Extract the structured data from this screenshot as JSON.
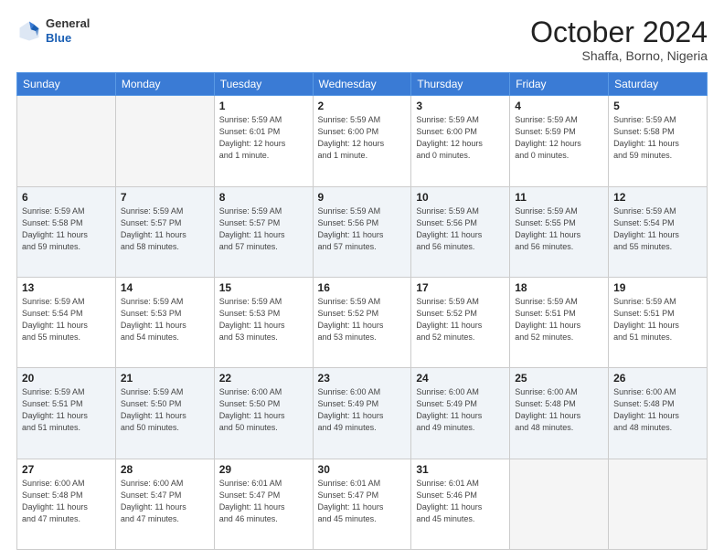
{
  "header": {
    "logo": {
      "general": "General",
      "blue": "Blue"
    },
    "title": "October 2024",
    "subtitle": "Shaffa, Borno, Nigeria"
  },
  "days_of_week": [
    "Sunday",
    "Monday",
    "Tuesday",
    "Wednesday",
    "Thursday",
    "Friday",
    "Saturday"
  ],
  "weeks": [
    [
      {
        "day": "",
        "detail": ""
      },
      {
        "day": "",
        "detail": ""
      },
      {
        "day": "1",
        "detail": "Sunrise: 5:59 AM\nSunset: 6:01 PM\nDaylight: 12 hours\nand 1 minute."
      },
      {
        "day": "2",
        "detail": "Sunrise: 5:59 AM\nSunset: 6:00 PM\nDaylight: 12 hours\nand 1 minute."
      },
      {
        "day": "3",
        "detail": "Sunrise: 5:59 AM\nSunset: 6:00 PM\nDaylight: 12 hours\nand 0 minutes."
      },
      {
        "day": "4",
        "detail": "Sunrise: 5:59 AM\nSunset: 5:59 PM\nDaylight: 12 hours\nand 0 minutes."
      },
      {
        "day": "5",
        "detail": "Sunrise: 5:59 AM\nSunset: 5:58 PM\nDaylight: 11 hours\nand 59 minutes."
      }
    ],
    [
      {
        "day": "6",
        "detail": "Sunrise: 5:59 AM\nSunset: 5:58 PM\nDaylight: 11 hours\nand 59 minutes."
      },
      {
        "day": "7",
        "detail": "Sunrise: 5:59 AM\nSunset: 5:57 PM\nDaylight: 11 hours\nand 58 minutes."
      },
      {
        "day": "8",
        "detail": "Sunrise: 5:59 AM\nSunset: 5:57 PM\nDaylight: 11 hours\nand 57 minutes."
      },
      {
        "day": "9",
        "detail": "Sunrise: 5:59 AM\nSunset: 5:56 PM\nDaylight: 11 hours\nand 57 minutes."
      },
      {
        "day": "10",
        "detail": "Sunrise: 5:59 AM\nSunset: 5:56 PM\nDaylight: 11 hours\nand 56 minutes."
      },
      {
        "day": "11",
        "detail": "Sunrise: 5:59 AM\nSunset: 5:55 PM\nDaylight: 11 hours\nand 56 minutes."
      },
      {
        "day": "12",
        "detail": "Sunrise: 5:59 AM\nSunset: 5:54 PM\nDaylight: 11 hours\nand 55 minutes."
      }
    ],
    [
      {
        "day": "13",
        "detail": "Sunrise: 5:59 AM\nSunset: 5:54 PM\nDaylight: 11 hours\nand 55 minutes."
      },
      {
        "day": "14",
        "detail": "Sunrise: 5:59 AM\nSunset: 5:53 PM\nDaylight: 11 hours\nand 54 minutes."
      },
      {
        "day": "15",
        "detail": "Sunrise: 5:59 AM\nSunset: 5:53 PM\nDaylight: 11 hours\nand 53 minutes."
      },
      {
        "day": "16",
        "detail": "Sunrise: 5:59 AM\nSunset: 5:52 PM\nDaylight: 11 hours\nand 53 minutes."
      },
      {
        "day": "17",
        "detail": "Sunrise: 5:59 AM\nSunset: 5:52 PM\nDaylight: 11 hours\nand 52 minutes."
      },
      {
        "day": "18",
        "detail": "Sunrise: 5:59 AM\nSunset: 5:51 PM\nDaylight: 11 hours\nand 52 minutes."
      },
      {
        "day": "19",
        "detail": "Sunrise: 5:59 AM\nSunset: 5:51 PM\nDaylight: 11 hours\nand 51 minutes."
      }
    ],
    [
      {
        "day": "20",
        "detail": "Sunrise: 5:59 AM\nSunset: 5:51 PM\nDaylight: 11 hours\nand 51 minutes."
      },
      {
        "day": "21",
        "detail": "Sunrise: 5:59 AM\nSunset: 5:50 PM\nDaylight: 11 hours\nand 50 minutes."
      },
      {
        "day": "22",
        "detail": "Sunrise: 6:00 AM\nSunset: 5:50 PM\nDaylight: 11 hours\nand 50 minutes."
      },
      {
        "day": "23",
        "detail": "Sunrise: 6:00 AM\nSunset: 5:49 PM\nDaylight: 11 hours\nand 49 minutes."
      },
      {
        "day": "24",
        "detail": "Sunrise: 6:00 AM\nSunset: 5:49 PM\nDaylight: 11 hours\nand 49 minutes."
      },
      {
        "day": "25",
        "detail": "Sunrise: 6:00 AM\nSunset: 5:48 PM\nDaylight: 11 hours\nand 48 minutes."
      },
      {
        "day": "26",
        "detail": "Sunrise: 6:00 AM\nSunset: 5:48 PM\nDaylight: 11 hours\nand 48 minutes."
      }
    ],
    [
      {
        "day": "27",
        "detail": "Sunrise: 6:00 AM\nSunset: 5:48 PM\nDaylight: 11 hours\nand 47 minutes."
      },
      {
        "day": "28",
        "detail": "Sunrise: 6:00 AM\nSunset: 5:47 PM\nDaylight: 11 hours\nand 47 minutes."
      },
      {
        "day": "29",
        "detail": "Sunrise: 6:01 AM\nSunset: 5:47 PM\nDaylight: 11 hours\nand 46 minutes."
      },
      {
        "day": "30",
        "detail": "Sunrise: 6:01 AM\nSunset: 5:47 PM\nDaylight: 11 hours\nand 45 minutes."
      },
      {
        "day": "31",
        "detail": "Sunrise: 6:01 AM\nSunset: 5:46 PM\nDaylight: 11 hours\nand 45 minutes."
      },
      {
        "day": "",
        "detail": ""
      },
      {
        "day": "",
        "detail": ""
      }
    ]
  ]
}
